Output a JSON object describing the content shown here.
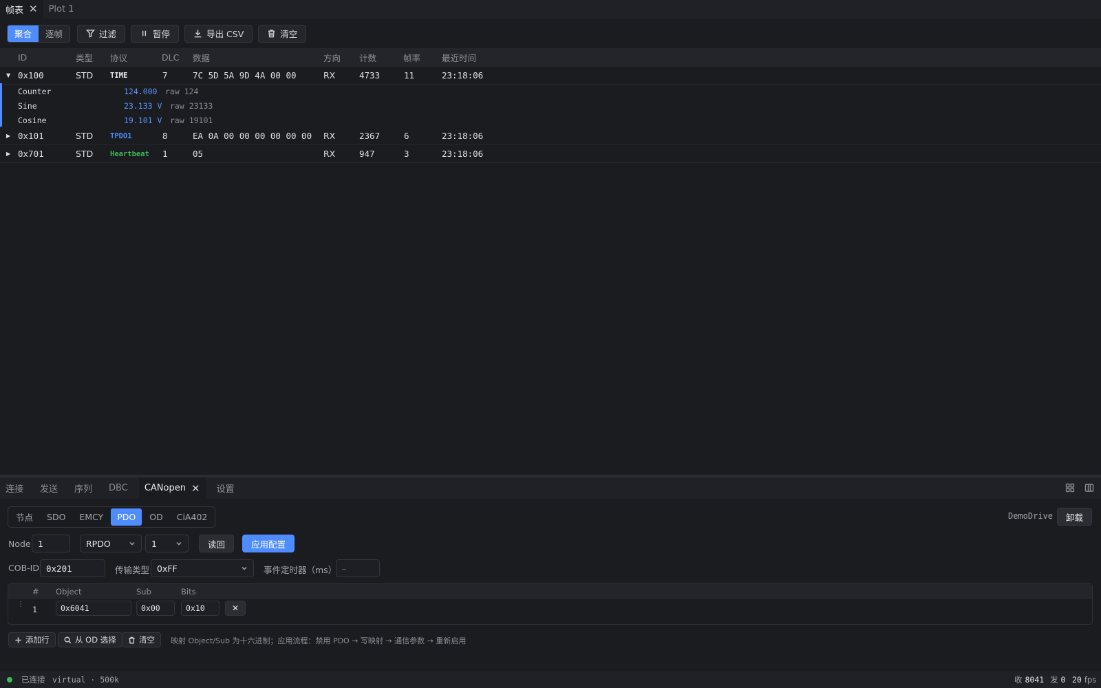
{
  "top_tabs": [
    {
      "label": "帧表",
      "active": true
    },
    {
      "label": "Plot 1",
      "active": false
    }
  ],
  "toolbar": {
    "mode": [
      "聚合",
      "逐帧"
    ],
    "filter": "过滤",
    "pause": "暂停",
    "export": "导出 CSV",
    "clear": "清空"
  },
  "table": {
    "headers": [
      "ID",
      "类型",
      "协议",
      "DLC",
      "数据",
      "方向",
      "计数",
      "帧率",
      "最近时间"
    ],
    "rows": [
      {
        "expanded": true,
        "id": "0x100",
        "type": "STD",
        "protocol": "TIME",
        "dlc": "7",
        "data": "7C 5D 5A 9D 4A 00 00",
        "dir": "RX",
        "count": "4733",
        "rate": "11",
        "time": "23:18:06",
        "signals": [
          {
            "name": "Counter",
            "value": "124.000",
            "raw": "raw 124"
          },
          {
            "name": "Sine",
            "value": "23.133 V",
            "raw": "raw 23133"
          },
          {
            "name": "Cosine",
            "value": "19.101 V",
            "raw": "raw 19101"
          }
        ]
      },
      {
        "expanded": false,
        "id": "0x101",
        "type": "STD",
        "protocol": "TPDO1",
        "dlc": "8",
        "data": "EA 0A 00 00 00 00 00 00",
        "dir": "RX",
        "count": "2367",
        "rate": "6",
        "time": "23:18:06"
      },
      {
        "expanded": false,
        "id": "0x701",
        "type": "STD",
        "protocol": "Heartbeat",
        "dlc": "1",
        "data": "05",
        "dir": "RX",
        "count": "947",
        "rate": "3",
        "time": "23:18:06"
      }
    ]
  },
  "bottom_tabs": [
    "连接",
    "发送",
    "序列",
    "DBC",
    "CANopen",
    "设置"
  ],
  "canopen": {
    "subtabs": [
      "节点",
      "SDO",
      "EMCY",
      "PDO",
      "OD",
      "CiA402"
    ],
    "device": "DemoDrive",
    "unload": "卸载",
    "node_label": "Node",
    "node_value": "1",
    "pdo_type": "RPDO",
    "pdo_index": "1",
    "read_back": "读回",
    "apply": "应用配置",
    "cobid_label": "COB-ID",
    "cobid_value": "0x201",
    "trans_label": "传输类型",
    "trans_value": "0xFF",
    "timer_label": "事件定时器（ms）",
    "timer_placeholder": "–",
    "mapping_headers": [
      "#",
      "Object",
      "Sub",
      "Bits"
    ],
    "mapping_rows": [
      {
        "n": "1",
        "object": "0x6041",
        "sub": "0x00",
        "bits": "0x10"
      }
    ],
    "add_row": "添加行",
    "from_od": "从 OD 选择",
    "clear": "清空",
    "hint": "映射 Object/Sub 为十六进制；应用流程：禁用 PDO → 写映射 → 通信参数 → 重新启用"
  },
  "status": {
    "connected": "已连接",
    "iface": "virtual · 500k",
    "rx_label": "收",
    "rx": "8041",
    "tx_label": "发",
    "tx": "0",
    "fps": "20",
    "fps_unit": "fps"
  },
  "colors": {
    "accent": "#4f8cff",
    "rx": "#3fb95a",
    "heartbeat": "#3fb95a",
    "tpdo": "#4f8cff"
  }
}
